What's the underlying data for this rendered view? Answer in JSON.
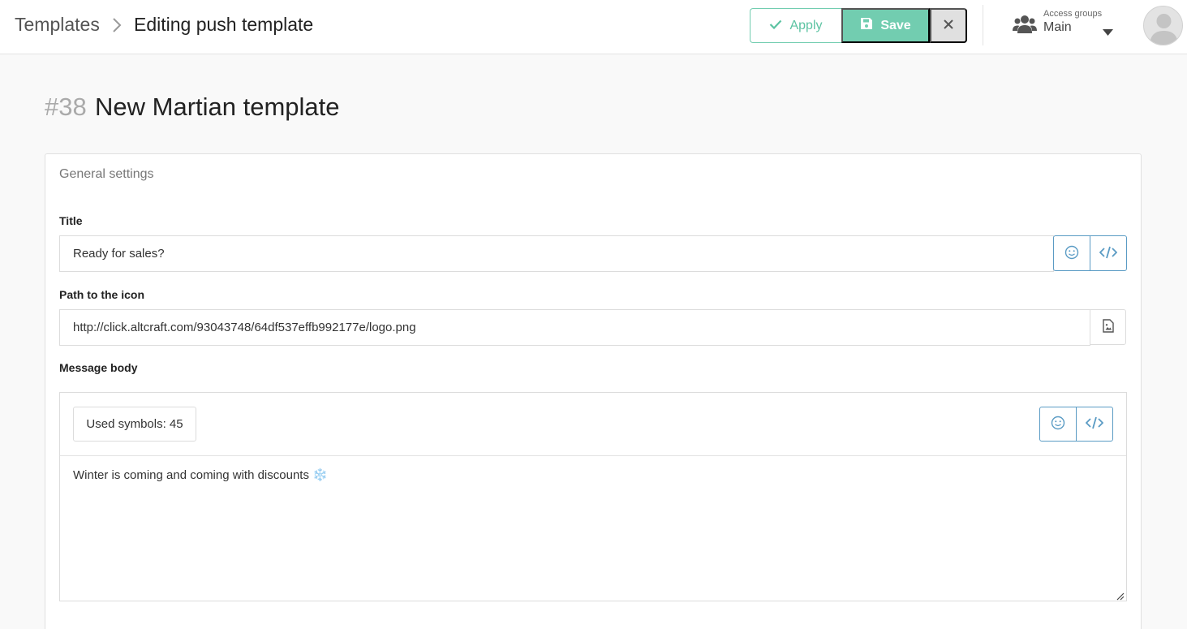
{
  "header": {
    "breadcrumb_root": "Templates",
    "breadcrumb_current": "Editing push template",
    "apply_label": "Apply",
    "save_label": "Save",
    "access_groups_label": "Access groups",
    "access_groups_value": "Main"
  },
  "page": {
    "id": "#38",
    "title": "New Martian template"
  },
  "general_settings": {
    "heading": "General settings",
    "title_label": "Title",
    "title_value": "Ready for sales?",
    "icon_path_label": "Path to the icon",
    "icon_path_value": "http://click.altcraft.com/93043748/64df537effb992177e/logo.png",
    "message_body_label": "Message body",
    "used_symbols": "Used symbols: 45",
    "message_body_value": "Winter is coming and coming with discounts ❄️"
  },
  "colors": {
    "accent_green": "#72cdb0",
    "accent_blue": "#5a9bc4"
  },
  "icons": {
    "breadcrumb": "chevron-right-icon",
    "apply": "check-icon",
    "save": "floppy-disk-icon",
    "close": "close-icon",
    "access": "users-icon",
    "caret": "caret-down-icon",
    "emoji": "emoji-icon",
    "code": "code-icon",
    "file": "image-file-icon"
  }
}
